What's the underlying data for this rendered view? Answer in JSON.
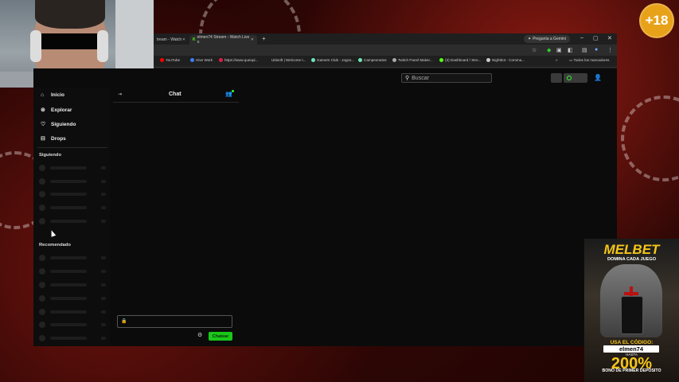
{
  "overlay": {
    "age_badge": "+18"
  },
  "browser": {
    "tabs": [
      {
        "label": "tream - Watch"
      },
      {
        "label": "elmen74 Stream - Watch Live o"
      }
    ],
    "new_tab": "+",
    "gemini_button": "Pregunta a Gemini",
    "window_controls": [
      "–",
      "▢",
      "✕"
    ],
    "bookmarks": [
      {
        "label": "YouTube",
        "color": "#ff0000"
      },
      {
        "label": "Hive Work",
        "color": "#3b82f6"
      },
      {
        "label": "https://www.queopi...",
        "color": "#e11d48"
      },
      {
        "label": "Ubisoft | Welcome t...",
        "color": "#888888"
      },
      {
        "label": "Gamers Club - Jogos...",
        "color": "#6ee7b7"
      },
      {
        "label": "Campeonatos",
        "color": "#6ee7b7"
      },
      {
        "label": "Twitch Panel Maker...",
        "color": "#aaaaaa"
      },
      {
        "label": "(3) Dashboard / Stre...",
        "color": "#53fc18"
      },
      {
        "label": "Nightbot - Comma...",
        "color": "#cccccc"
      }
    ],
    "bookmarks_more": "»",
    "all_bookmarks": "Todos los marcadores"
  },
  "page": {
    "search_placeholder": "Buscar",
    "nav": [
      {
        "label": "Inicio",
        "icon": "home-icon"
      },
      {
        "label": "Explorar",
        "icon": "compass-icon"
      },
      {
        "label": "Siguiendo",
        "icon": "heart-icon"
      },
      {
        "label": "Drops",
        "icon": "gift-icon"
      }
    ],
    "sections": {
      "following": "Siguiendo",
      "recommended": "Recomendado"
    },
    "chat": {
      "title": "Chat",
      "send_button": "Chatear"
    }
  },
  "ad": {
    "brand": "MELBET",
    "tagline": "DOMINA CADA JUEGO",
    "code_label": "USA EL CÓDIGO:",
    "code": "elmen74",
    "hasta": "HASTA",
    "bonus_percent": "200%",
    "bonus_text": "BONO DE PRIMER DEPÓSITO"
  }
}
